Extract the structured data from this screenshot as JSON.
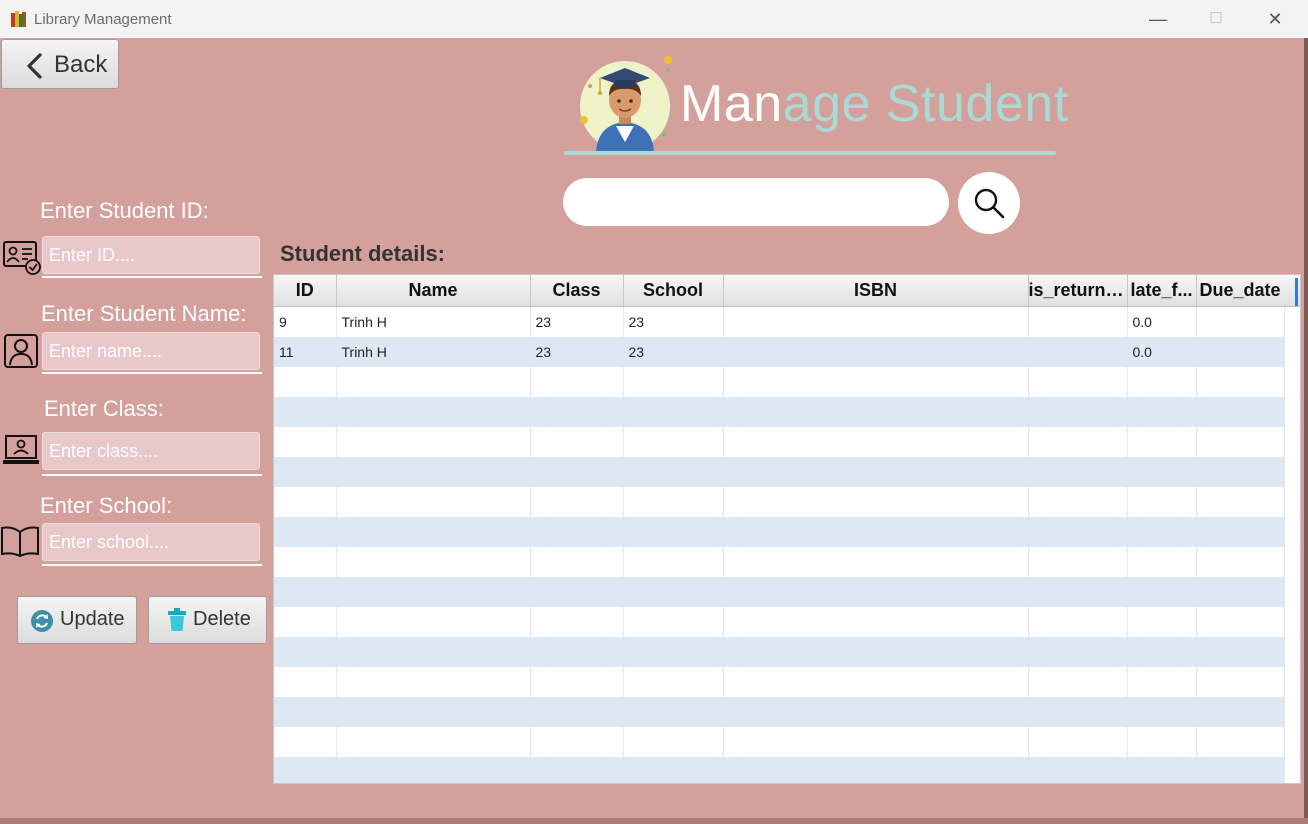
{
  "window": {
    "title": "Library Management",
    "minimize": "—",
    "maximize": "☐",
    "close": "✕"
  },
  "back_button": {
    "label": "Back"
  },
  "header": {
    "title_part1": "Man",
    "title_part2": "age Student"
  },
  "search": {
    "value": "",
    "placeholder": ""
  },
  "form": {
    "id": {
      "label": "Enter Student ID:",
      "placeholder": "Enter ID...."
    },
    "name": {
      "label": "Enter Student Name:",
      "placeholder": "Enter name...."
    },
    "class": {
      "label": "Enter Class:",
      "placeholder": "Enter class...."
    },
    "school": {
      "label": "Enter School:",
      "placeholder": "Enter school...."
    }
  },
  "actions": {
    "update": "Update",
    "delete": "Delete"
  },
  "table": {
    "title": "Student details:",
    "columns": [
      "ID",
      "Name",
      "Class",
      "School",
      "ISBN",
      "is_returned",
      "late_f...",
      "Due_date"
    ],
    "rows": [
      [
        "9",
        "Trinh H",
        "23",
        "23",
        "",
        "",
        "0.0",
        ""
      ],
      [
        "11",
        "Trinh H",
        "23",
        "23",
        "",
        "",
        "0.0",
        ""
      ]
    ]
  },
  "colors": {
    "background": "#d4a09c",
    "accent": "#a9dad6",
    "row_alt": "#dce8f4"
  }
}
